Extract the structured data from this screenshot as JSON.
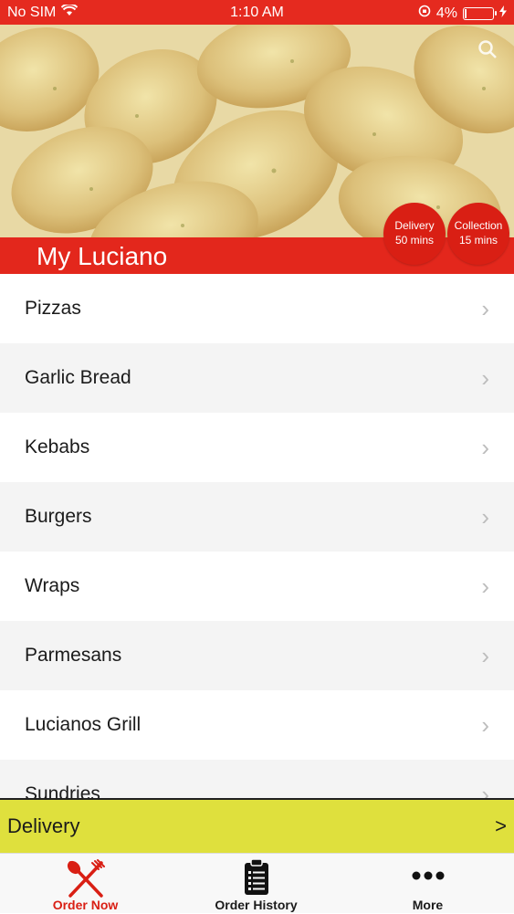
{
  "status_bar": {
    "carrier": "No SIM",
    "time": "1:10 AM",
    "battery": "4%"
  },
  "header": {
    "restaurant_name": "My Luciano",
    "delivery_badge": {
      "title": "Delivery",
      "time": "50 mins"
    },
    "collection_badge": {
      "title": "Collection",
      "time": "15 mins"
    }
  },
  "menu": {
    "categories": [
      {
        "label": "Pizzas"
      },
      {
        "label": "Garlic Bread"
      },
      {
        "label": "Kebabs"
      },
      {
        "label": "Burgers"
      },
      {
        "label": "Wraps"
      },
      {
        "label": "Parmesans"
      },
      {
        "label": "Lucianos Grill"
      },
      {
        "label": "Sundries"
      }
    ]
  },
  "order_mode_bar": {
    "label": "Delivery",
    "arrow": ">"
  },
  "tabs": [
    {
      "label": "Order Now",
      "icon": "fork-knife-icon"
    },
    {
      "label": "Order History",
      "icon": "clipboard-icon"
    },
    {
      "label": "More",
      "icon": "more-dots-icon"
    }
  ],
  "colors": {
    "brand_red": "#e3271c",
    "delivery_bar": "#dfe03d"
  }
}
